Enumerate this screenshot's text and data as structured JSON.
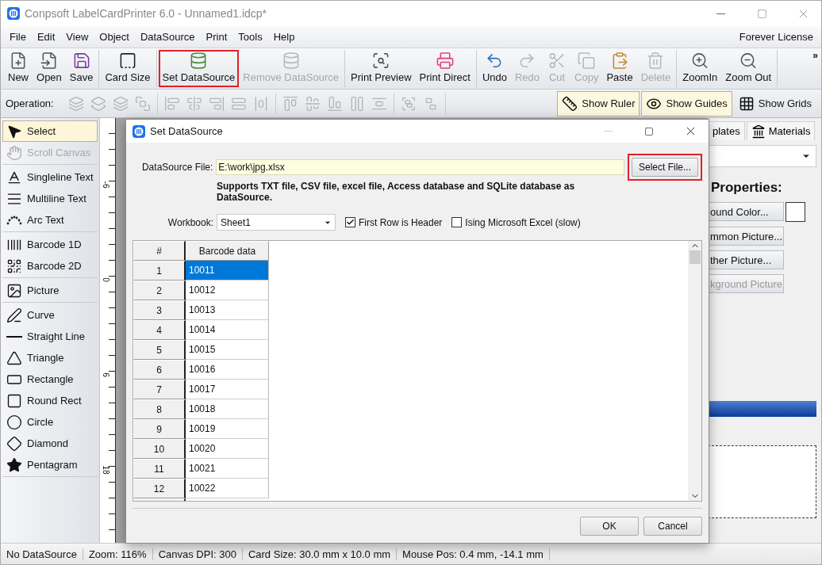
{
  "window": {
    "title": "Conpsoft LabelCardPrinter 6.0 - Unnamed1.idcp*"
  },
  "menu": {
    "items": [
      "File",
      "Edit",
      "View",
      "Object",
      "DataSource",
      "Print",
      "Tools",
      "Help"
    ],
    "license": "Forever License"
  },
  "toolbar": {
    "overflow": "»",
    "groups": [
      [
        {
          "label": "New",
          "disabled": false,
          "highlighted": false
        },
        {
          "label": "Open",
          "disabled": false,
          "highlighted": false
        },
        {
          "label": "Save",
          "disabled": false,
          "highlighted": false
        }
      ],
      [
        {
          "label": "Card Size",
          "disabled": false,
          "highlighted": false
        }
      ],
      [
        {
          "label": "Set DataSource",
          "disabled": false,
          "highlighted": true
        },
        {
          "label": "Remove DataSource",
          "disabled": true,
          "highlighted": false
        }
      ],
      [
        {
          "label": "Print Preview",
          "disabled": false,
          "highlighted": false
        },
        {
          "label": "Print Direct",
          "disabled": false,
          "highlighted": false
        }
      ],
      [
        {
          "label": "Undo",
          "disabled": false,
          "highlighted": false
        },
        {
          "label": "Redo",
          "disabled": true,
          "highlighted": false
        },
        {
          "label": "Cut",
          "disabled": true,
          "highlighted": false
        },
        {
          "label": "Copy",
          "disabled": true,
          "highlighted": false
        },
        {
          "label": "Paste",
          "disabled": false,
          "highlighted": false
        },
        {
          "label": "Delete",
          "disabled": true,
          "highlighted": false
        }
      ],
      [
        {
          "label": "ZoomIn",
          "disabled": false,
          "highlighted": false
        },
        {
          "label": "Zoom Out",
          "disabled": false,
          "highlighted": false
        }
      ]
    ]
  },
  "operation_bar": {
    "label": "Operation:",
    "groups": [
      [
        {
          "disabled": true
        },
        {
          "disabled": true
        },
        {
          "disabled": true
        },
        {
          "disabled": true
        }
      ],
      [
        {
          "disabled": true
        },
        {
          "disabled": true
        },
        {
          "disabled": true
        },
        {
          "disabled": true
        },
        {
          "disabled": true
        }
      ],
      [
        {
          "disabled": true
        },
        {
          "disabled": true
        },
        {
          "disabled": true
        },
        {
          "disabled": true
        },
        {
          "disabled": true
        }
      ],
      [
        {
          "disabled": true
        },
        {
          "disabled": true
        }
      ]
    ],
    "toggles": [
      {
        "label": "Show Ruler",
        "on": true
      },
      {
        "label": "Show Guides",
        "on": true
      },
      {
        "label": "Show Grids",
        "on": false
      }
    ]
  },
  "left_tools": [
    [
      {
        "label": "Select",
        "selected": true,
        "disabled": false
      },
      {
        "label": "Scroll Canvas",
        "selected": false,
        "disabled": true
      }
    ],
    [
      {
        "label": "Singleline Text",
        "selected": false,
        "disabled": false
      },
      {
        "label": "Multiline Text",
        "selected": false,
        "disabled": false
      },
      {
        "label": "Arc Text",
        "selected": false,
        "disabled": false
      }
    ],
    [
      {
        "label": "Barcode 1D",
        "selected": false,
        "disabled": false
      },
      {
        "label": "Barcode 2D",
        "selected": false,
        "disabled": false
      }
    ],
    [
      {
        "label": "Picture",
        "selected": false,
        "disabled": false
      }
    ],
    [
      {
        "label": "Curve",
        "selected": false,
        "disabled": false
      },
      {
        "label": "Straight Line",
        "selected": false,
        "disabled": false
      },
      {
        "label": "Triangle",
        "selected": false,
        "disabled": false
      },
      {
        "label": "Rectangle",
        "selected": false,
        "disabled": false
      },
      {
        "label": "Round Rect",
        "selected": false,
        "disabled": false
      },
      {
        "label": "Circle",
        "selected": false,
        "disabled": false
      },
      {
        "label": "Diamond",
        "selected": false,
        "disabled": false
      },
      {
        "label": "Pentagram",
        "selected": false,
        "disabled": false
      }
    ]
  ],
  "ruler": {
    "labels": [
      "-6",
      "0",
      "6",
      "18"
    ]
  },
  "right_panel": {
    "tabs": [
      "plates",
      "Materials"
    ],
    "heading": "Properties:",
    "buttons": [
      {
        "label": "ound Color...",
        "disabled": false
      },
      {
        "label": "mmon Picture...",
        "disabled": false
      },
      {
        "label": "ther Picture...",
        "disabled": false
      },
      {
        "label": "kground Picture",
        "disabled": true
      }
    ]
  },
  "dialog": {
    "title": "Set DataSource",
    "file_label": "DataSource File:",
    "file_value": "E:\\work\\jpg.xlsx",
    "select_button": {
      "label": "Select File...",
      "highlighted": true
    },
    "note": "Supports TXT file, CSV file, excel file, Access database and SQLite database as DataSource.",
    "workbook_label": "Workbook:",
    "workbook_value": "Sheet1",
    "options": [
      {
        "label": "First Row is Header",
        "checked": true
      },
      {
        "label": "Ising Microsoft Excel (slow)",
        "checked": false
      }
    ],
    "table": {
      "columns": [
        "#",
        "Barcode data"
      ],
      "rows": [
        {
          "cells": [
            "1",
            "10011"
          ],
          "selected": true
        },
        {
          "cells": [
            "2",
            "10012"
          ],
          "selected": false
        },
        {
          "cells": [
            "3",
            "10013"
          ],
          "selected": false
        },
        {
          "cells": [
            "4",
            "10014"
          ],
          "selected": false
        },
        {
          "cells": [
            "5",
            "10015"
          ],
          "selected": false
        },
        {
          "cells": [
            "6",
            "10016"
          ],
          "selected": false
        },
        {
          "cells": [
            "7",
            "10017"
          ],
          "selected": false
        },
        {
          "cells": [
            "8",
            "10018"
          ],
          "selected": false
        },
        {
          "cells": [
            "9",
            "10019"
          ],
          "selected": false
        },
        {
          "cells": [
            "10",
            "10020"
          ],
          "selected": false
        },
        {
          "cells": [
            "11",
            "10021"
          ],
          "selected": false
        },
        {
          "cells": [
            "12",
            "10022"
          ],
          "selected": false
        }
      ]
    },
    "buttons": [
      "OK",
      "Cancel"
    ]
  },
  "status_bar": [
    "No DataSource",
    "Zoom: 116%",
    "Canvas DPI: 300",
    "Card Size: 30.0 mm x 10.0 mm",
    "Mouse Pos: 0.4 mm, -14.1 mm"
  ]
}
